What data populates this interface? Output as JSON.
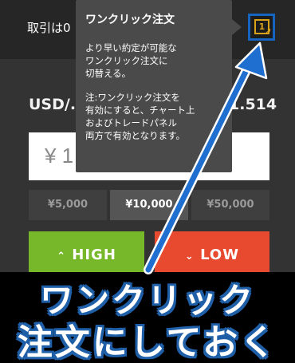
{
  "topbar": {
    "trade_label": "取引は0",
    "oneclick_icon_text": "1"
  },
  "instrument": {
    "pair": "USD/.",
    "rate": "1.514"
  },
  "amount": {
    "value": "¥ 1"
  },
  "presets": [
    {
      "label": "¥5,000",
      "active": false
    },
    {
      "label": "¥10,000",
      "active": true
    },
    {
      "label": "¥50,000",
      "active": false
    }
  ],
  "buttons": {
    "high": "HIGH",
    "low": "LOW"
  },
  "tooltip": {
    "title": "ワンクリック注文",
    "body_lines": [
      "より早い約定が可能な",
      "ワンクリック注文に",
      "切替える。"
    ],
    "note_lines": [
      "注:ワンクリック注文を",
      "有効にすると、チャート上",
      "およびトレードパネル",
      "両方で有効となります。"
    ]
  },
  "caption": {
    "line1": "ワンクリック",
    "line2": "注文にしておく"
  },
  "colors": {
    "accent_blue": "#1e5fa8",
    "high_green": "#76b82a",
    "low_red": "#e84a30",
    "icon_gold": "#d9a21b"
  },
  "icons": {
    "oneclick": "one-click-order-icon",
    "cursor": "cursor-arrow-icon",
    "high": "chevron-up-icon",
    "low": "chevron-down-icon"
  }
}
